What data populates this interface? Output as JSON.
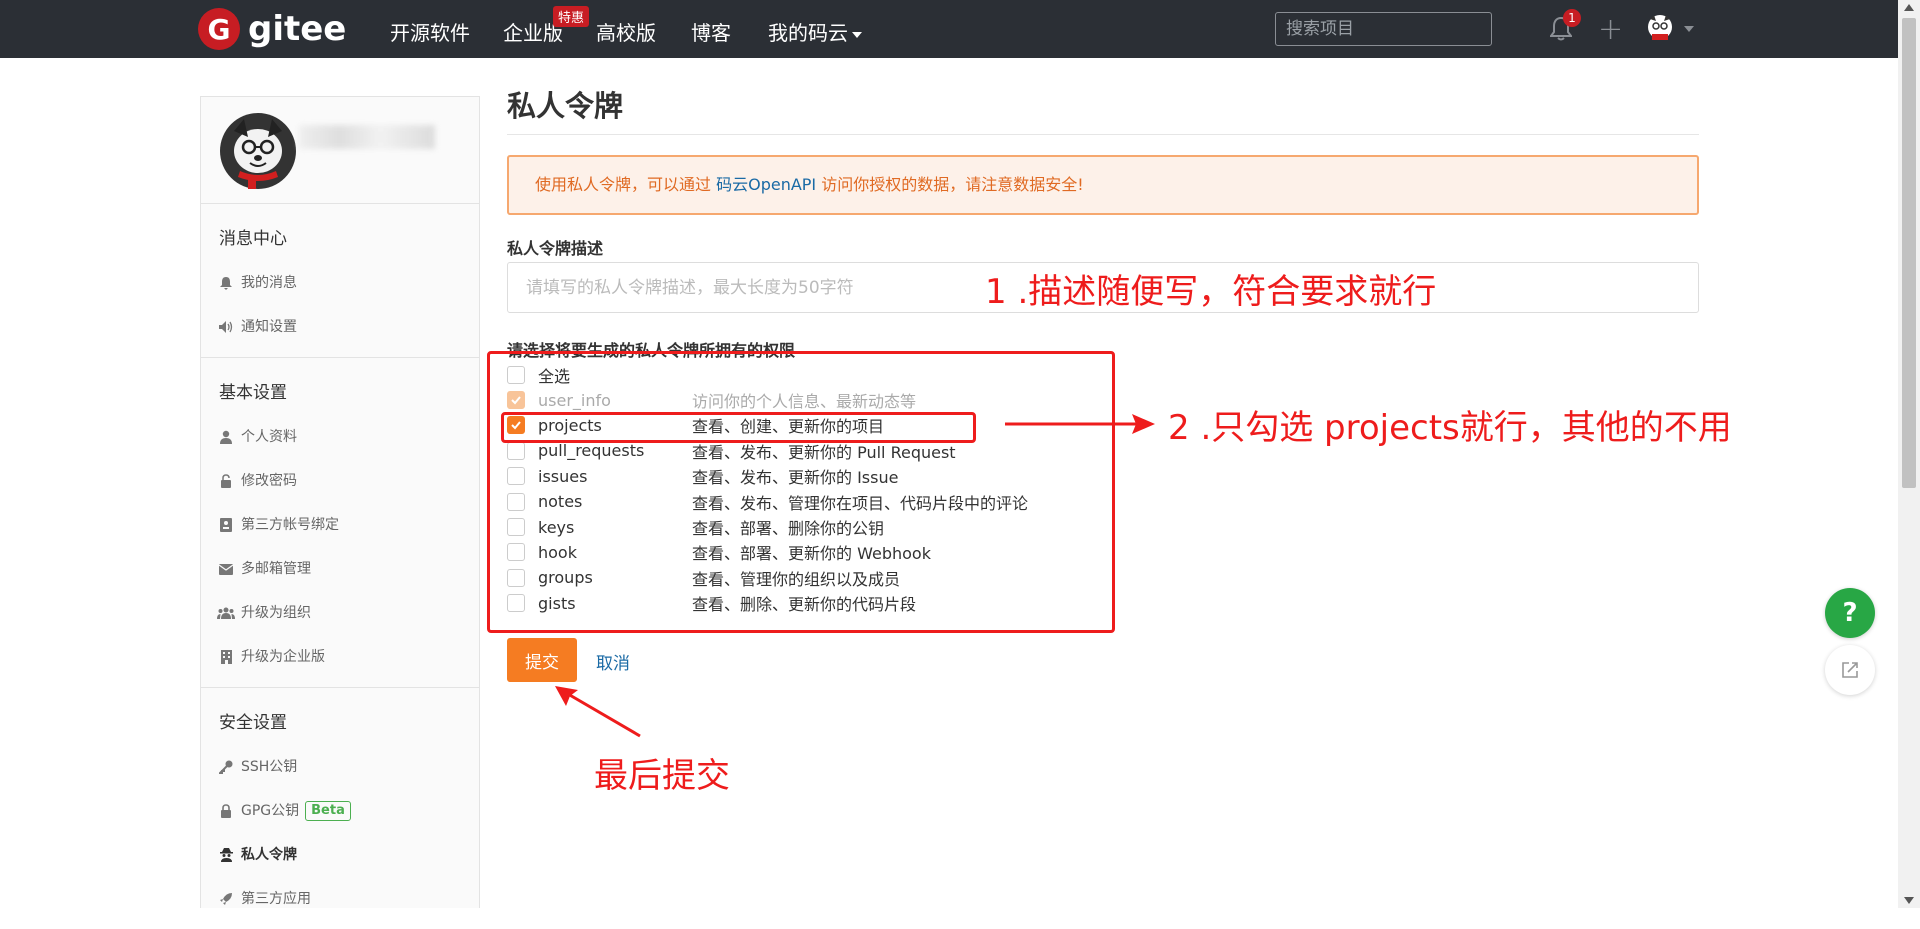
{
  "navbar": {
    "logo_text": "gitee",
    "items": [
      {
        "label": "开源软件"
      },
      {
        "label": "企业版"
      },
      {
        "label": "高校版"
      },
      {
        "label": "博客"
      },
      {
        "label": "我的码云"
      }
    ],
    "enterprise_badge": "特惠",
    "search_placeholder": "搜索项目",
    "notification_count": "1",
    "plus": "+"
  },
  "sidebar": {
    "sections": [
      {
        "heading": "消息中心",
        "items": [
          {
            "label": "我的消息",
            "icon": "bell-icon"
          },
          {
            "label": "通知设置",
            "icon": "speaker-icon"
          }
        ]
      },
      {
        "heading": "基本设置",
        "items": [
          {
            "label": "个人资料",
            "icon": "user-icon"
          },
          {
            "label": "修改密码",
            "icon": "unlock-icon"
          },
          {
            "label": "第三方帐号绑定",
            "icon": "id-card-icon"
          },
          {
            "label": "多邮箱管理",
            "icon": "envelope-icon"
          },
          {
            "label": "升级为组织",
            "icon": "users-icon"
          },
          {
            "label": "升级为企业版",
            "icon": "building-icon"
          }
        ]
      },
      {
        "heading": "安全设置",
        "items": [
          {
            "label": "SSH公钥",
            "icon": "key-icon"
          },
          {
            "label": "GPG公钥",
            "icon": "lock-icon",
            "badge": "Beta"
          },
          {
            "label": "私人令牌",
            "icon": "user-secret-icon",
            "active": true
          },
          {
            "label": "第三方应用",
            "icon": "rocket-icon"
          }
        ]
      }
    ]
  },
  "main": {
    "title": "私人令牌",
    "alert_prefix": "使用私人令牌，可以通过 ",
    "alert_link": "码云OpenAPI",
    "alert_suffix": " 访问你授权的数据，请注意数据安全!",
    "desc_label": "私人令牌描述",
    "desc_placeholder": "请填写的私人令牌描述，最大长度为50字符",
    "perm_label": "请选择将要生成的私人令牌所拥有的权限",
    "select_all": "全选",
    "permissions": [
      {
        "name": "user_info",
        "desc": "访问你的个人信息、最新动态等",
        "checked": true,
        "disabled": true
      },
      {
        "name": "projects",
        "desc": "查看、创建、更新你的项目",
        "checked": true,
        "disabled": false
      },
      {
        "name": "pull_requests",
        "desc": "查看、发布、更新你的 Pull Request",
        "checked": false,
        "disabled": false
      },
      {
        "name": "issues",
        "desc": "查看、发布、更新你的 Issue",
        "checked": false,
        "disabled": false
      },
      {
        "name": "notes",
        "desc": "查看、发布、管理你在项目、代码片段中的评论",
        "checked": false,
        "disabled": false
      },
      {
        "name": "keys",
        "desc": "查看、部署、删除你的公钥",
        "checked": false,
        "disabled": false
      },
      {
        "name": "hook",
        "desc": "查看、部署、更新你的 Webhook",
        "checked": false,
        "disabled": false
      },
      {
        "name": "groups",
        "desc": "查看、管理你的组织以及成员",
        "checked": false,
        "disabled": false
      },
      {
        "name": "gists",
        "desc": "查看、删除、更新你的代码片段",
        "checked": false,
        "disabled": false
      }
    ],
    "submit_label": "提交",
    "cancel_label": "取消"
  },
  "annotations": {
    "step1": "1 .描述随便写，符合要求就行",
    "step2": "2 .只勾选 projects就行，其他的不用",
    "step3": "最后提交",
    "color": "#ee1c1c"
  },
  "floating": {
    "help_label": "?"
  },
  "colors": {
    "accent": "#f57c22",
    "navbar": "#2b2f35",
    "brand": "#c71d23",
    "link": "#1a6aa5",
    "success": "#28a745"
  }
}
